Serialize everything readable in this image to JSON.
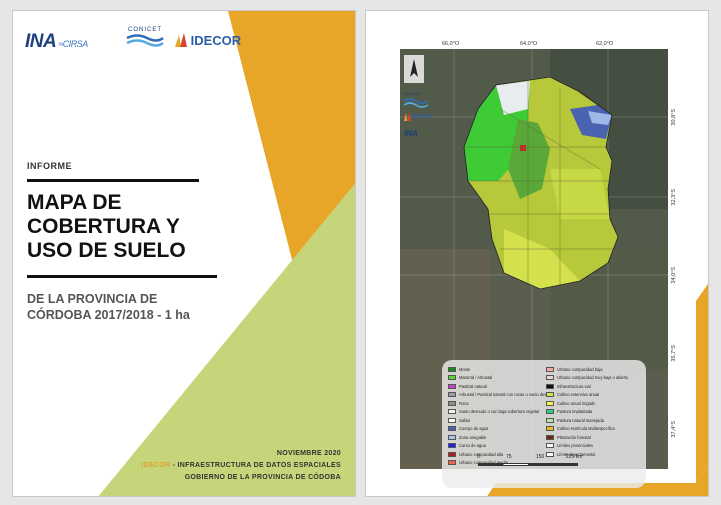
{
  "cover": {
    "logos": {
      "ina": "INA",
      "ina_sub": "CIRSA",
      "conicet": "CONICET",
      "idecor": "IDECOR"
    },
    "label": "INFORME",
    "title_lines": [
      "MAPA DE",
      "COBERTURA Y",
      "USO DE SUELO"
    ],
    "subtitle_lines": [
      "DE LA PROVINCIA DE",
      "CÓRDOBA 2017/2018 - 1 ha"
    ],
    "footer": {
      "date": "NOVIEMBRE 2020",
      "org_highlight": "IDECOR",
      "org_rest": " - INFRAESTRUCTURA DE DATOS ESPACIALES",
      "gov": "GOBIERNO DE LA PROVINCIA DE CÓDOBA"
    },
    "colors": {
      "orange": "#e8a628",
      "green": "#c6d57a"
    }
  },
  "map": {
    "coords_top": [
      "66,0°O",
      "64,0°O",
      "62,0°O"
    ],
    "coords_right": [
      "30,8°S",
      "32,3°S",
      "34,0°S",
      "35,7°S",
      "37,4°S"
    ],
    "logo_labels": {
      "conicet": "CONICET",
      "idecor": "IDECOR",
      "ina": "INA"
    },
    "legend_left": [
      {
        "label": "Monte",
        "color": "#1f8a1f"
      },
      {
        "label": "Matorral / Arbustal",
        "color": "#5fcf3a"
      },
      {
        "label": "Pastizal natural",
        "color": "#c048c8"
      },
      {
        "label": "Arbustal / Pastizal natural con rocas o suelo desnudo",
        "color": "#9aa0a8"
      },
      {
        "label": "Roca",
        "color": "#8e8e8e"
      },
      {
        "label": "Suelo desnudo o con baja cobertura vegetal",
        "color": "#f2f2f2"
      },
      {
        "label": "Salina",
        "color": "#ffffff"
      },
      {
        "label": "Cuerpo de agua",
        "color": "#4a63b0"
      },
      {
        "label": "Zona anegable",
        "color": "#a6c6ee"
      },
      {
        "label": "Curso de agua",
        "color": "#1d22d8"
      },
      {
        "label": "Urbano compacidad alta",
        "color": "#b01e1e"
      },
      {
        "label": "Urbano compacidad media",
        "color": "#e86a4a"
      }
    ],
    "legend_right": [
      {
        "label": "Urbano compacidad baja",
        "color": "#f3a9a0"
      },
      {
        "label": "Urbano compacidad muy baja o abierto",
        "color": "#e9d6cf"
      },
      {
        "label": "Infraestructura vial",
        "color": "#111111"
      },
      {
        "label": "Cultivo extensivo anual",
        "color": "#d9e34a"
      },
      {
        "label": "Cultivo anual irrigado",
        "color": "#f5f542"
      },
      {
        "label": "Pastura implantada",
        "color": "#2fd07a"
      },
      {
        "label": "Pastura natural manejada",
        "color": "#b8e6a0"
      },
      {
        "label": "Cultivo Hortícola Multiespecífico",
        "color": "#e8b820"
      },
      {
        "label": "Plantación forestal",
        "color": "#6b2a12"
      },
      {
        "label": "Límites provinciales",
        "color": "#ffffff"
      },
      {
        "label": "Límite departamental",
        "color": "#ffffff"
      }
    ],
    "scale": {
      "t0": "0",
      "t1": "75",
      "t2": "150",
      "t3": "225 km"
    }
  }
}
